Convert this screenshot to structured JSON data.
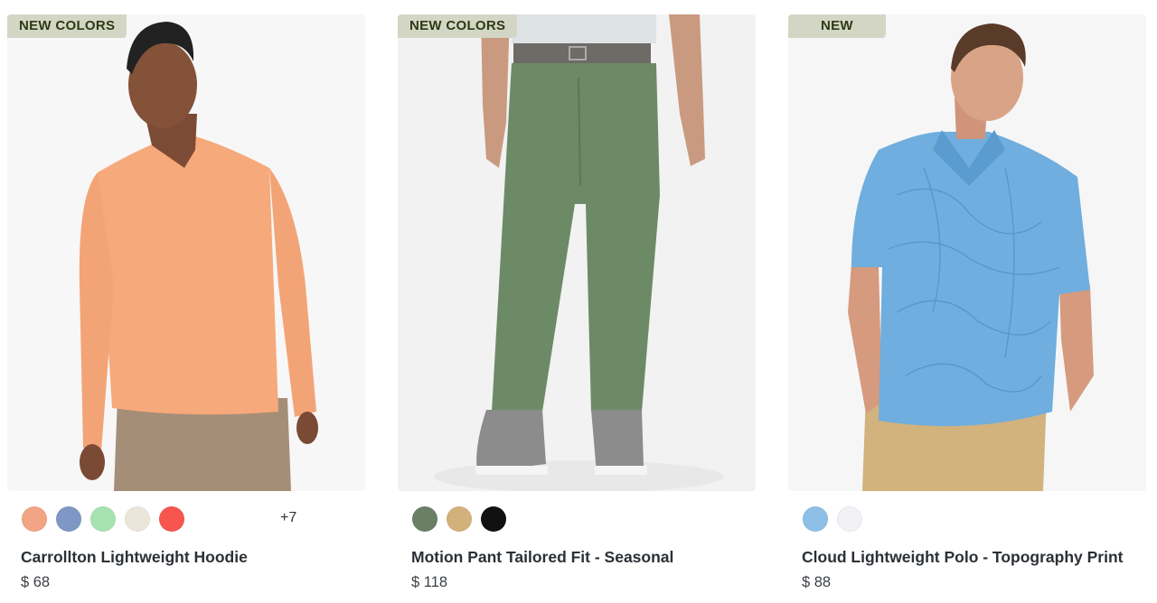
{
  "products": [
    {
      "badge": "NEW COLORS",
      "name": "Carrollton Lightweight Hoodie",
      "price": "$ 68",
      "swatches": [
        "#f2a585",
        "#7f97c4",
        "#a7e3b0",
        "#ece6da",
        "#f7564f"
      ],
      "more_colors": "+7",
      "image": "man in orange lightweight hoodie and tan shorts"
    },
    {
      "badge": "NEW COLORS",
      "name": "Motion Pant Tailored Fit - Seasonal",
      "price": "$ 118",
      "swatches": [
        "#6b7e66",
        "#d2b27a",
        "#111111"
      ],
      "more_colors": "",
      "image": "green tailored pants with grey sneakers"
    },
    {
      "badge": "NEW",
      "name": "Cloud Lightweight Polo - Topography Print",
      "price": "$ 88",
      "swatches": [
        "#8ebfe6",
        "#f1f1f6"
      ],
      "more_colors": "",
      "image": "man in light blue topography print polo"
    }
  ]
}
